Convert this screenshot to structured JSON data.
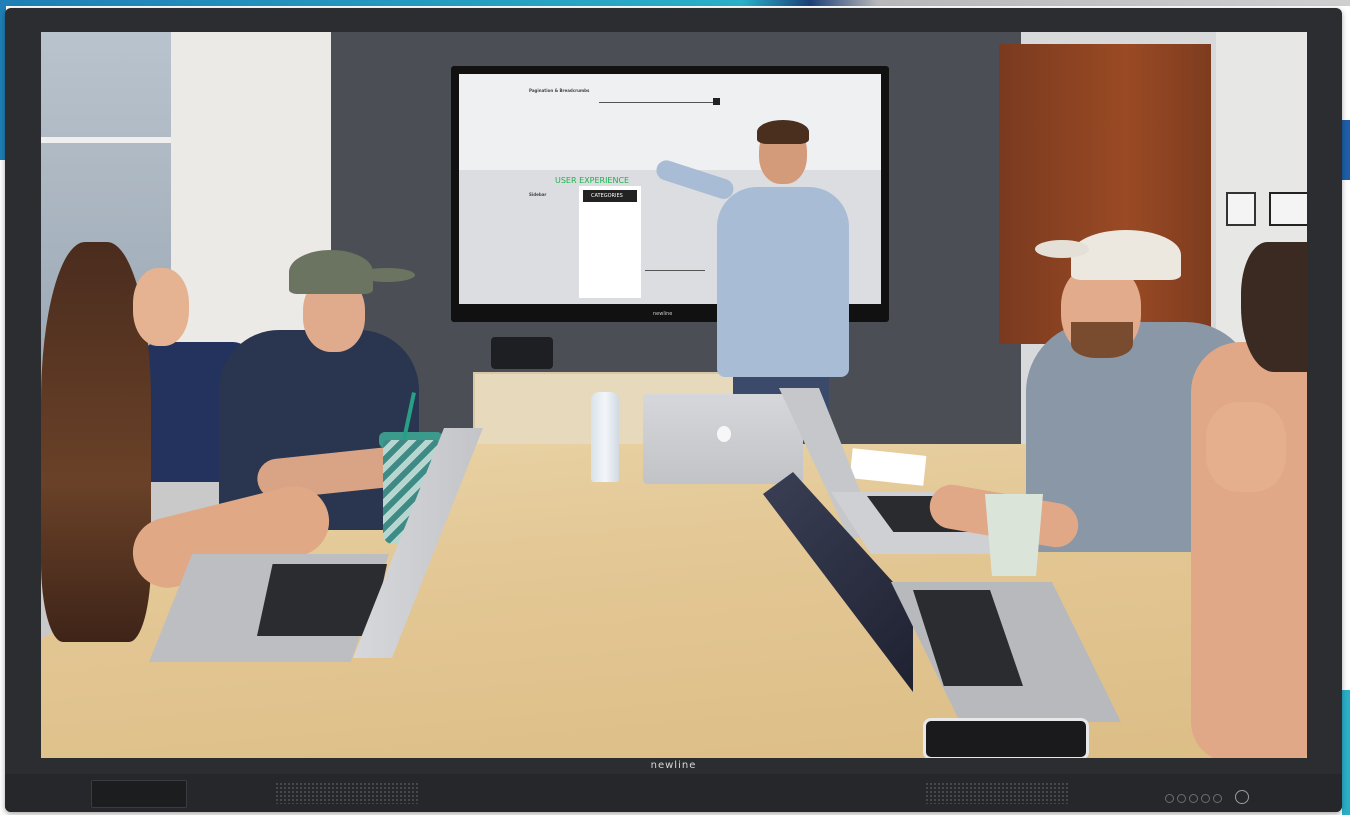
{
  "display": {
    "brand_label": "newline"
  },
  "scene": {
    "board_handwriting": "USER EXPERIENCE",
    "board_heading_top": "Pagination & Breadcrumbs",
    "board_heading_mid": "Sidebar",
    "board_category_label": "CATEGORIES",
    "tv_brand_label": "newline"
  },
  "colors": {
    "bezel": "#2c2d30",
    "accent_band": "#1f7fb6",
    "table_wood": "#e3c794"
  }
}
